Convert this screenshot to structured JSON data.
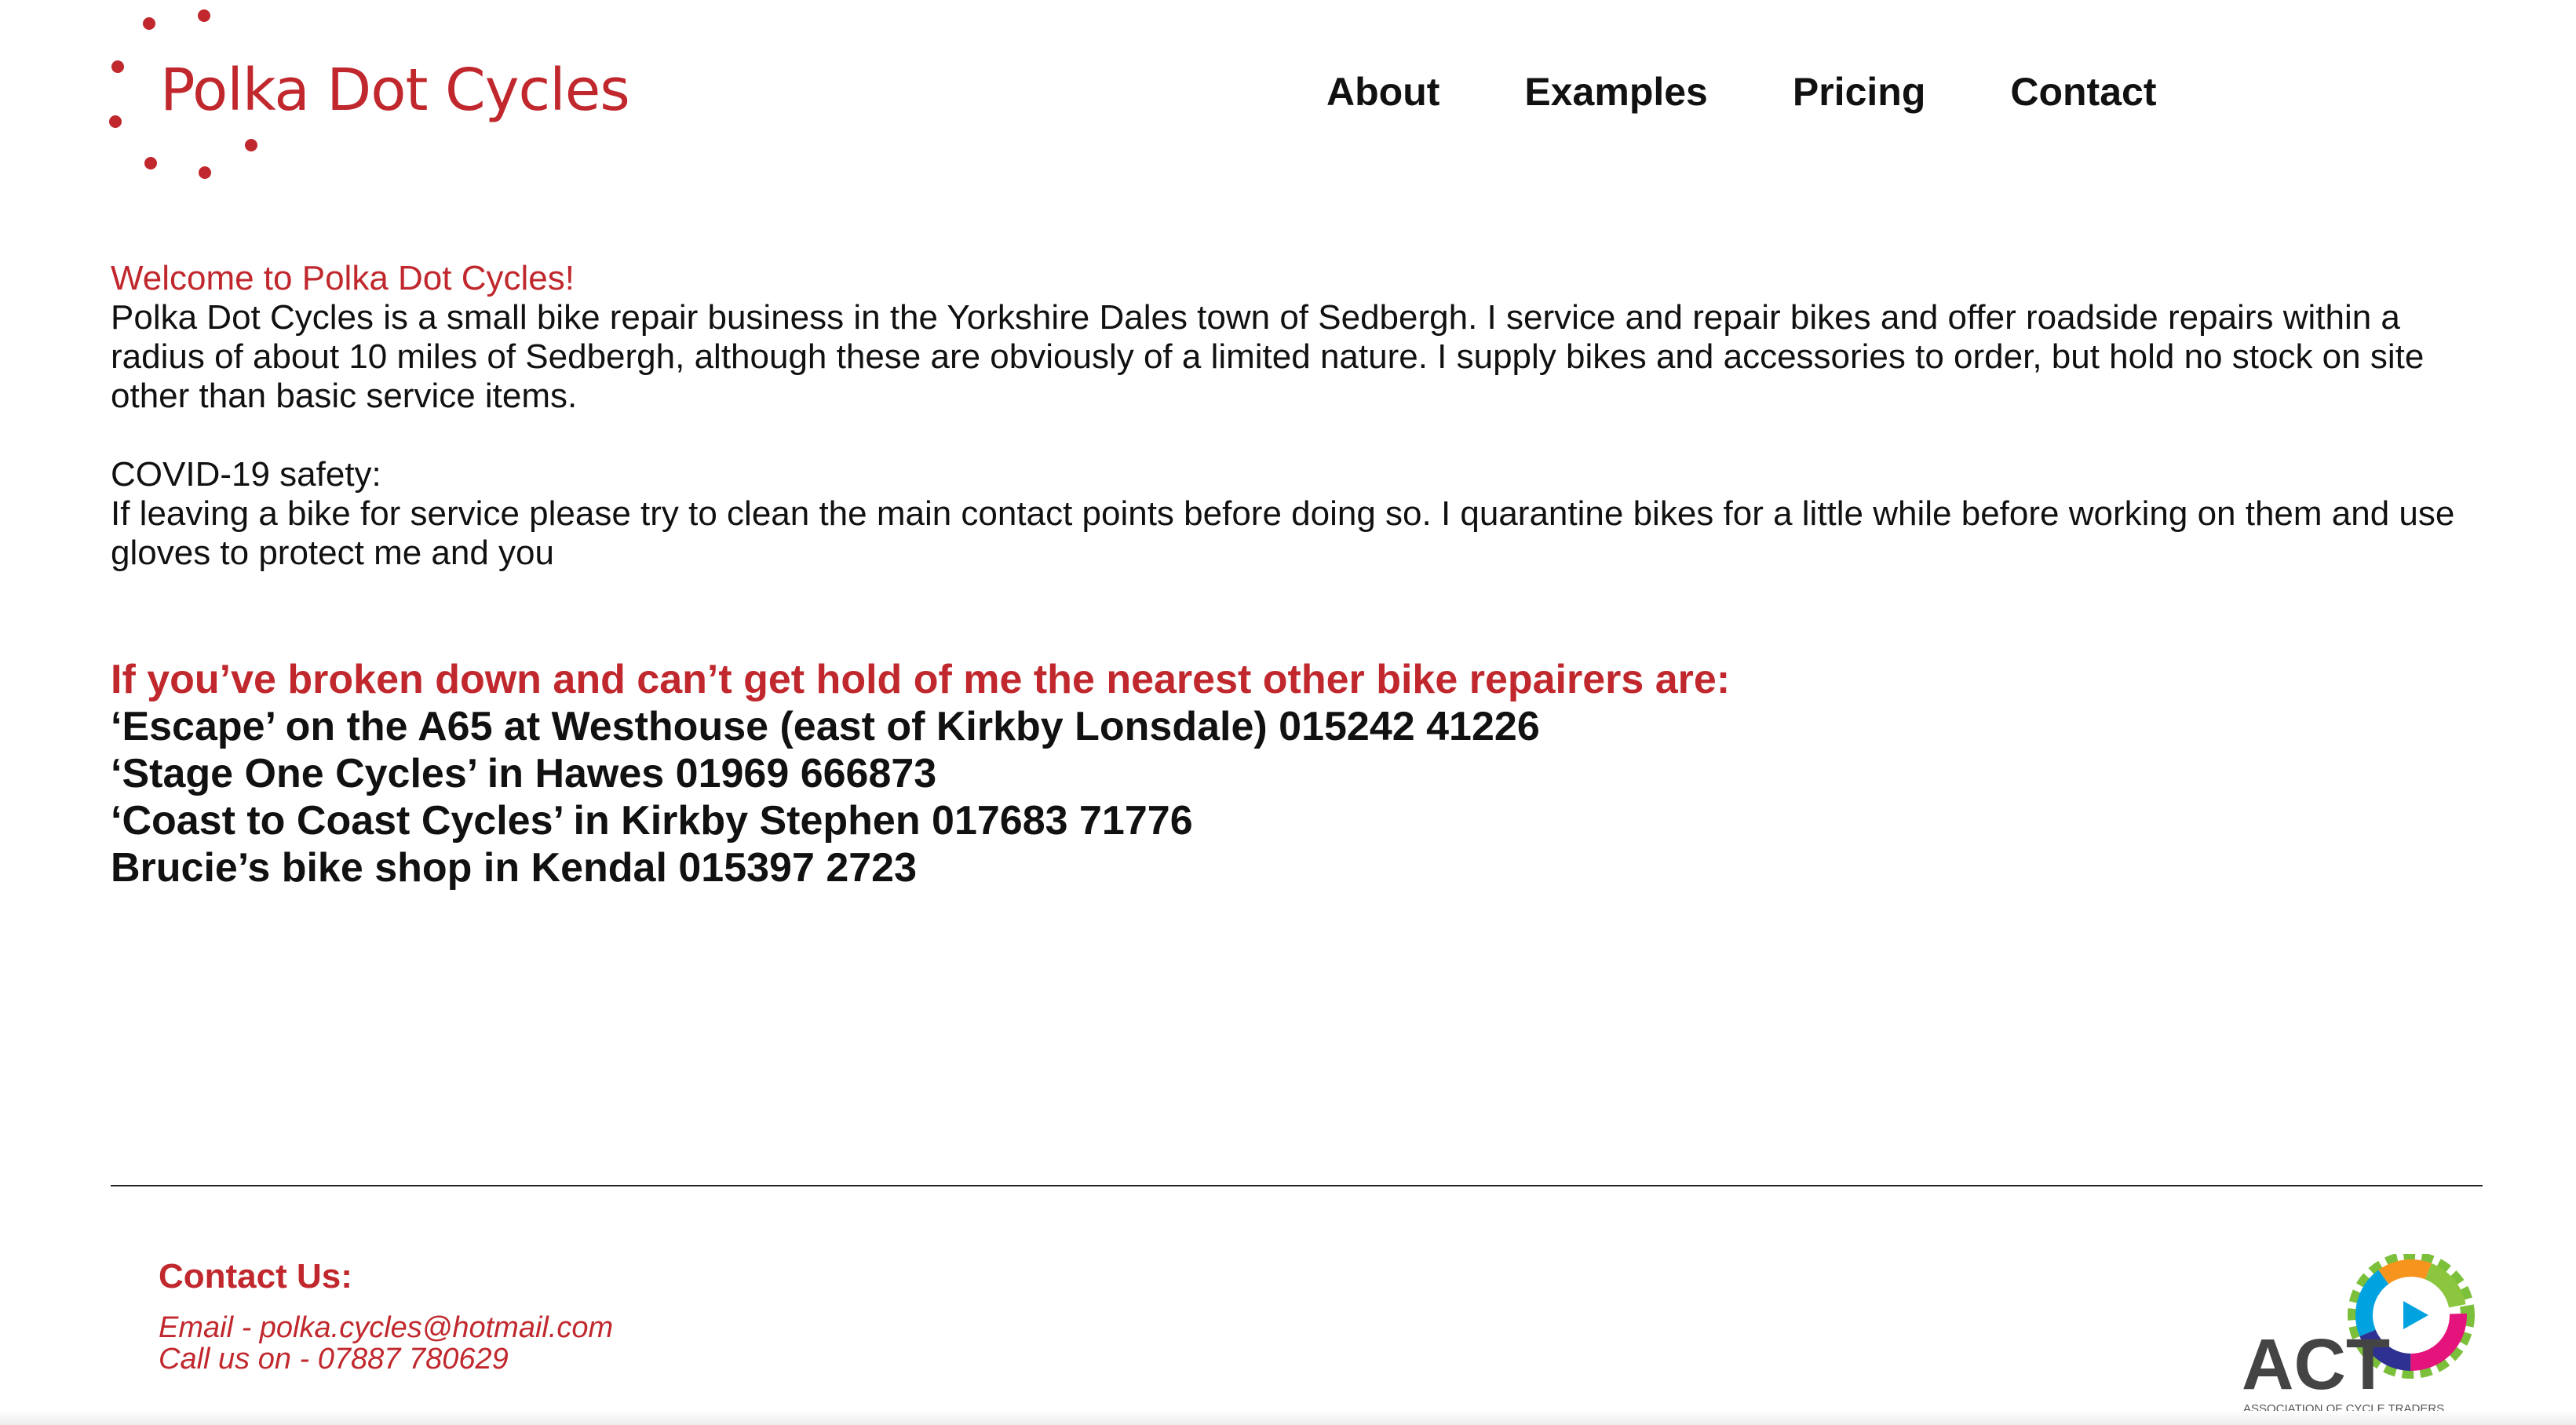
{
  "brand": {
    "name": "Polka Dot Cycles",
    "accent_color": "#c0282d"
  },
  "nav": {
    "items": [
      {
        "label": "About"
      },
      {
        "label": "Examples"
      },
      {
        "label": "Pricing"
      },
      {
        "label": "Contact"
      }
    ]
  },
  "main": {
    "welcome": "Welcome to Polka Dot Cycles!",
    "intro": "Polka Dot Cycles is a small bike repair business in the Yorkshire Dales town of Sedbergh. I service and repair bikes and offer roadside repairs within a radius of about 10 miles of Sedbergh, although these are obviously of a limited nature. I supply bikes and accessories to order, but hold no stock on site other than basic service items.",
    "covid_title": "COVID-19 safety:",
    "covid_text": "If leaving a bike for service please try to clean the main contact points before doing so. I quarantine bikes for a little while before working on them and use gloves to protect me and you",
    "repairers_heading": "If you’ve broken down and can’t get hold of me the nearest other bike repairers are:",
    "repairers": [
      "‘Escape’ on the A65 at Westhouse (east of Kirkby Lonsdale) 015242 41226",
      "‘Stage One Cycles’ in Hawes 01969 666873",
      "‘Coast to Coast Cycles’ in Kirkby Stephen 017683 71776",
      "Brucie’s bike shop in Kendal 015397 2723"
    ]
  },
  "footer": {
    "contact_title": "Contact Us:",
    "email_line": "Email - polka.cycles@hotmail.com",
    "phone_line": "Call us on - 07887 780629",
    "act_logo_text": "ACT",
    "act_logo_subtext": "ASSOCIATION OF CYCLE TRADERS"
  }
}
